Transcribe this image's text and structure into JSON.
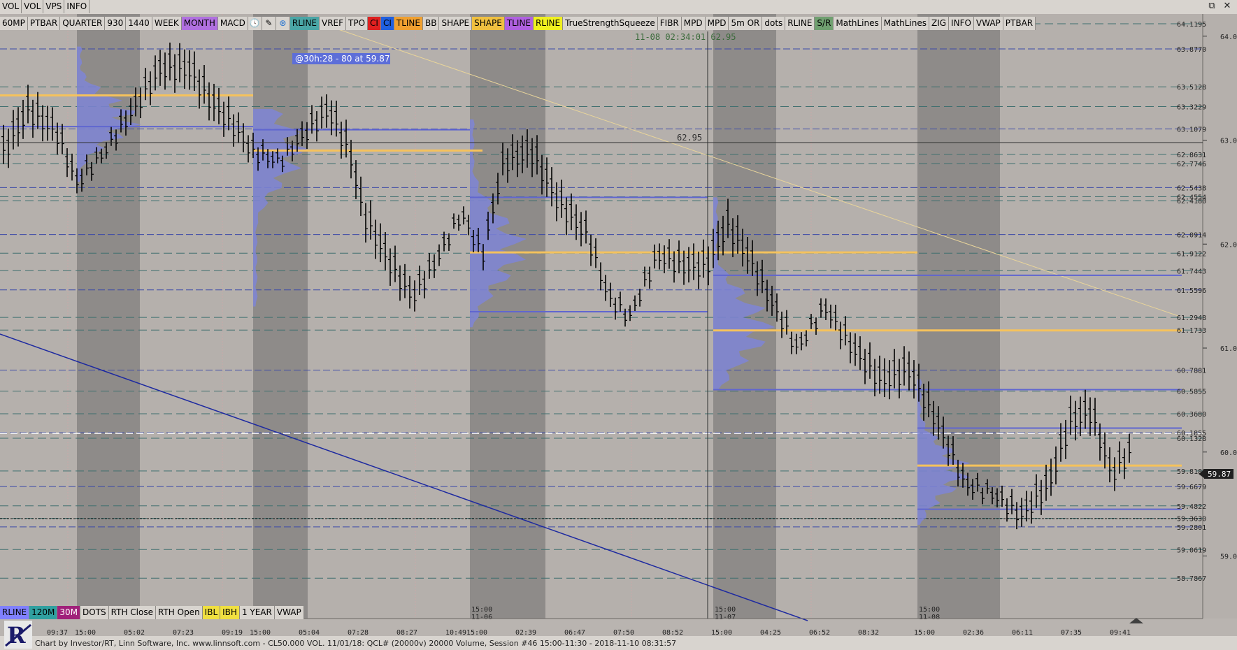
{
  "top_bar_1": [
    "VOL",
    "VOL",
    "VPS",
    "INFO"
  ],
  "toolbar": [
    {
      "label": "60MP"
    },
    {
      "label": "PTBAR"
    },
    {
      "label": "QUARTER"
    },
    {
      "label": "930"
    },
    {
      "label": "1440"
    },
    {
      "label": "WEEK"
    },
    {
      "label": "MONTH",
      "bg": "#b070e0"
    },
    {
      "label": "MACD"
    },
    {
      "icon": "clock-icon"
    },
    {
      "icon": "pencil-icon"
    },
    {
      "icon": "scanner-icon"
    },
    {
      "label": "RLINE",
      "bg": "#4aa6a6"
    },
    {
      "label": "VREF"
    },
    {
      "label": "TPO"
    },
    {
      "label": "CI",
      "bg": "#e02020"
    },
    {
      "label": "CI",
      "bg": "#2060e0"
    },
    {
      "label": "TLINE",
      "bg": "#f0a030"
    },
    {
      "label": "BB"
    },
    {
      "label": "SHAPE"
    },
    {
      "label": "SHAPE",
      "bg": "#f0c040"
    },
    {
      "label": "TLINE",
      "bg": "#b060e0"
    },
    {
      "label": "RLINE",
      "bg": "#f0f020"
    },
    {
      "label": "TrueStrengthSqueeze"
    },
    {
      "label": "FIBR"
    },
    {
      "label": "MPD"
    },
    {
      "label": "MPD"
    },
    {
      "label": "5m OR"
    },
    {
      "label": "dots"
    },
    {
      "label": "RLINE"
    },
    {
      "label": "S/R",
      "bg": "#70a070"
    },
    {
      "label": "MathLines"
    },
    {
      "label": "MathLines"
    },
    {
      "label": "ZIG"
    },
    {
      "label": "INFO"
    },
    {
      "label": "VWAP"
    },
    {
      "label": "PTBAR"
    }
  ],
  "bottom_toolbar": [
    {
      "label": "RLINE",
      "bg": "#8080ff"
    },
    {
      "label": "120M",
      "bg": "#30a0a0"
    },
    {
      "label": "30M",
      "bg": "#a0207a"
    },
    {
      "label": "DOTS"
    },
    {
      "label": "RTH Close"
    },
    {
      "label": "RTH Open"
    },
    {
      "label": "IBL",
      "bg": "#f0e040"
    },
    {
      "label": "IBH",
      "bg": "#f0e040"
    },
    {
      "label": "1 YEAR"
    },
    {
      "label": "VWAP"
    }
  ],
  "window_controls": [
    "⧉",
    "✕"
  ],
  "chart": {
    "crosshair_readout": "11-08 02:34:01 62.95",
    "crosshair_price": "62.95",
    "annotation": "@30h:28 - 80 at 59.87",
    "last_price": "59.87",
    "price_axis": [
      "64.00",
      "63.00",
      "62.00",
      "61.00",
      "60.00",
      "59.00"
    ],
    "level_labels": [
      "64.1195",
      "63.8770",
      "63.5128",
      "63.3229",
      "63.1079",
      "62.8631",
      "62.7746",
      "62.5438",
      "62.4554",
      "62.4180",
      "62.0914",
      "61.9122",
      "61.7443",
      "61.5596",
      "61.2948",
      "61.1733",
      "60.7881",
      "60.5855",
      "60.3680",
      "60.1855",
      "60.1328",
      "59.8180",
      "59.6679",
      "59.4822",
      "59.3630",
      "59.2801",
      "59.0619",
      "58.7867"
    ],
    "time_labels": [
      "09:37",
      "15:00",
      "05:02",
      "07:23",
      "09:19",
      "15:00",
      "05:04",
      "07:28",
      "08:27",
      "10:49",
      "15:00",
      "02:39",
      "06:47",
      "07:50",
      "08:52",
      "15:00",
      "04:25",
      "06:52",
      "08:32",
      "15:00",
      "02:36",
      "06:11",
      "07:35",
      "09:41"
    ],
    "session_dates": [
      "11-06",
      "11-07",
      "11-08"
    ],
    "colors": {
      "poc": "#f5c25c",
      "profile": "#7f85d6",
      "session_shade": "#8e8b89",
      "trend_blue": "#1e2aa0",
      "trend_tan": "#e8d49a"
    }
  },
  "footer": {
    "text": "Chart by Investor/RT, Linn Software, Inc. www.linnsoft.com - CL50.000  VOL.  11/01/18: QCL# (20000v) 20000 Volume, Session #46 15:00-11:30 - 2018-11-10 08:31:57",
    "logo_icon": "investor-rt-logo-icon"
  }
}
